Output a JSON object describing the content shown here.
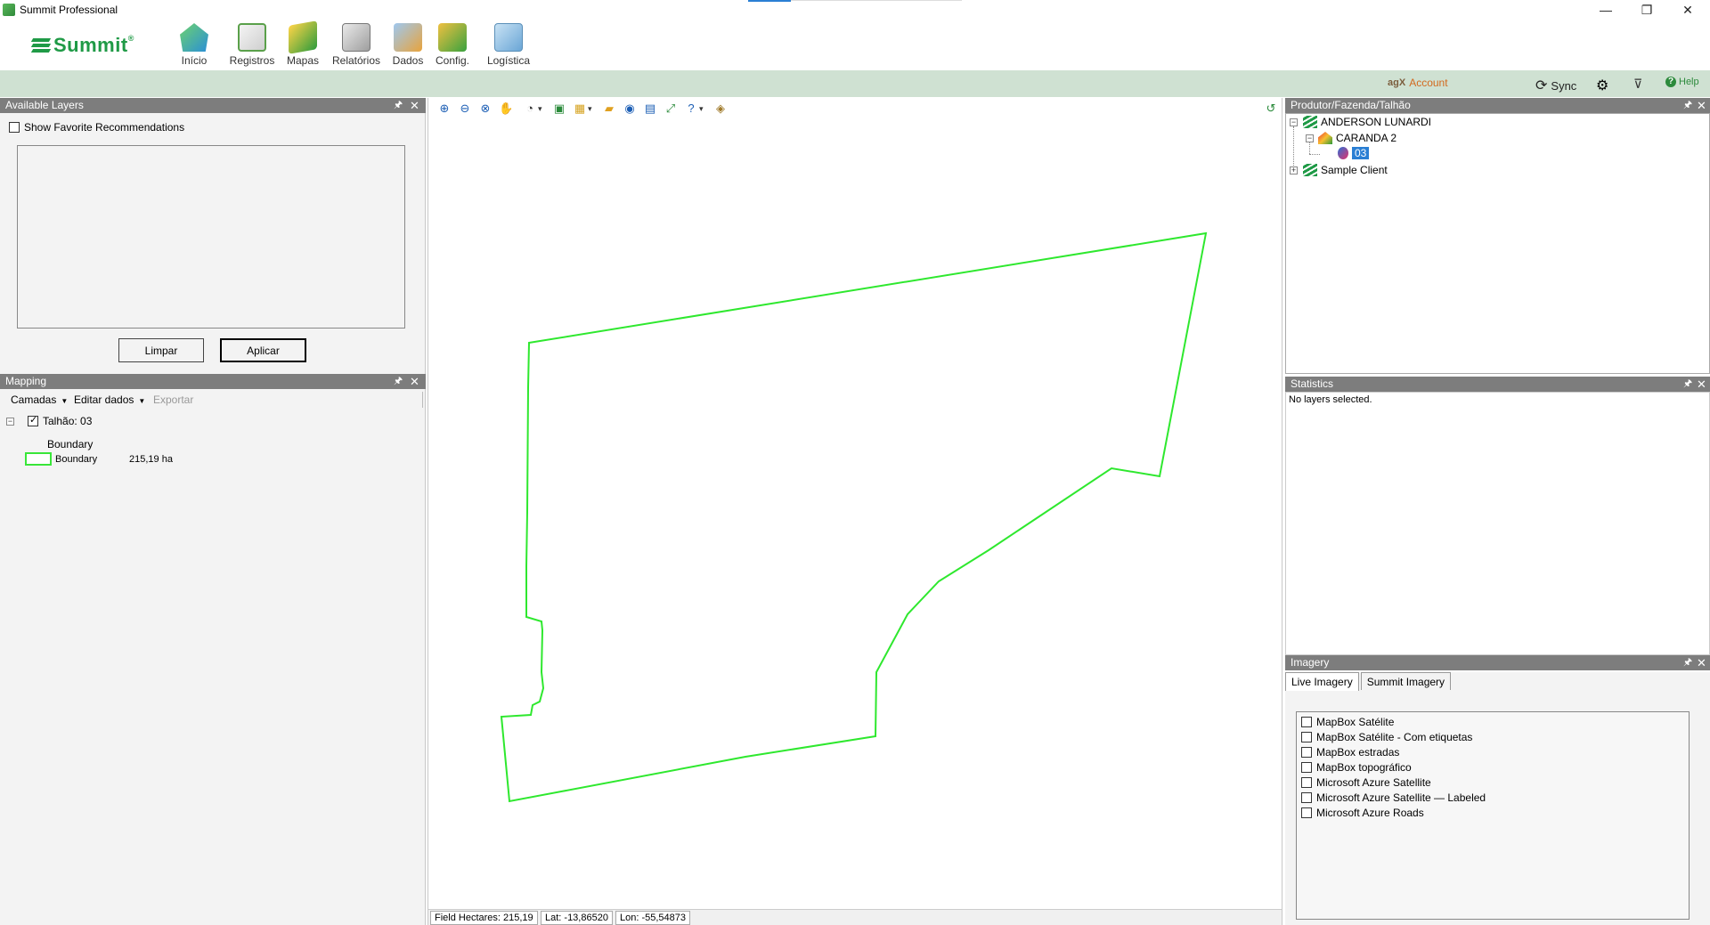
{
  "window": {
    "title": "Summit Professional",
    "controls": {
      "minimize": "—",
      "restore": "❐",
      "close": "✕"
    }
  },
  "ribbon": {
    "logo": "Summit",
    "logo_mark": "®",
    "buttons": [
      {
        "label": "Início",
        "icon": "home-icon"
      },
      {
        "label": "Registros",
        "icon": "notes-icon"
      },
      {
        "label": "Mapas",
        "icon": "maps-icon"
      },
      {
        "label": "Relatórios",
        "icon": "reports-icon"
      },
      {
        "label": "Dados",
        "icon": "data-icon"
      },
      {
        "label": "Config.",
        "icon": "config-icon"
      },
      {
        "label": "Logística",
        "icon": "logistics-icon"
      }
    ]
  },
  "accountbar": {
    "agx": "agX",
    "account": "Account",
    "sync": "Sync",
    "help": "Help",
    "colors": {
      "bar": "#cfe1d2",
      "account": "#d2691e",
      "help": "#2c8a3c"
    }
  },
  "available_layers": {
    "title": "Available Layers",
    "show_favorites_label": "Show Favorite Recommendations",
    "show_favorites_checked": false,
    "clear_button": "Limpar",
    "apply_button": "Aplicar"
  },
  "mapping": {
    "title": "Mapping",
    "toolbar": {
      "layers": "Camadas",
      "edit": "Editar dados",
      "export": "Exportar"
    },
    "tree": {
      "field_label": "Talhão: 03",
      "field_checked": true,
      "group_label": "Boundary",
      "legend_label": "Boundary",
      "legend_value": "215,19 ha",
      "legend_color": "#39e639"
    }
  },
  "map": {
    "boundary_color": "#2ee82e",
    "status": {
      "hectares": "Field Hectares: 215,19",
      "lat": "Lat: -13,86520",
      "lon": "Lon: -55,54873"
    }
  },
  "producer_tree": {
    "title": "Produtor/Fazenda/Talhão",
    "nodes": {
      "client1": "ANDERSON LUNARDI",
      "farm1": "CARANDA 2",
      "field1": "03",
      "client2": "Sample Client"
    }
  },
  "statistics": {
    "title": "Statistics",
    "message": "No layers selected."
  },
  "imagery": {
    "title": "Imagery",
    "tabs": [
      "Live Imagery",
      "Summit Imagery"
    ],
    "active_tab": "Live Imagery",
    "items": [
      {
        "label": "MapBox Satélite",
        "checked": false
      },
      {
        "label": "MapBox Satélite - Com etiquetas",
        "checked": false
      },
      {
        "label": "MapBox estradas",
        "checked": false
      },
      {
        "label": "MapBox topográfico",
        "checked": false
      },
      {
        "label": "Microsoft Azure Satellite",
        "checked": false
      },
      {
        "label": "Microsoft Azure Satellite — Labeled",
        "checked": false
      },
      {
        "label": "Microsoft Azure Roads",
        "checked": false
      }
    ]
  }
}
